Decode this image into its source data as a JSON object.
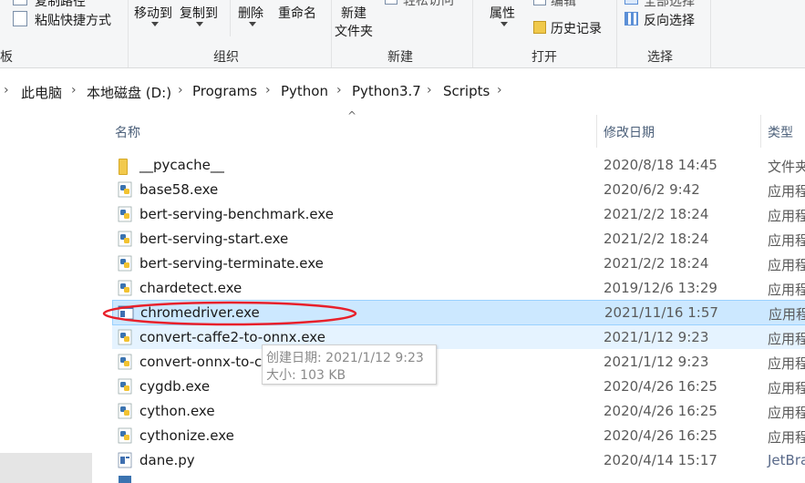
{
  "ribbon": {
    "copy_path": "复制路径",
    "paste_shortcut": "粘贴快捷方式",
    "move_to": "移动到",
    "copy_to": "复制到",
    "delete": "删除",
    "rename": "重命名",
    "new_folder_line1": "新建",
    "new_folder_line2": "文件夹",
    "easy_access": "轻松访问",
    "properties": "属性",
    "edit": "编辑",
    "history": "历史记录",
    "select_all": "全部选择",
    "invert_selection": "反向选择",
    "groups": {
      "clipboard_partial": "板",
      "organize": "组织",
      "new": "新建",
      "open": "打开",
      "select": "选择"
    }
  },
  "breadcrumb": [
    "此电脑",
    "本地磁盘 (D:)",
    "Programs",
    "Python",
    "Python3.7",
    "Scripts"
  ],
  "columns": {
    "name": "名称",
    "date": "修改日期",
    "type": "类型"
  },
  "files": [
    {
      "name": "__pycache__",
      "date": "2020/8/18 14:45",
      "type": "文件夹",
      "icon": "folder-icon"
    },
    {
      "name": "base58.exe",
      "date": "2020/6/2 9:42",
      "type": "应用程序",
      "icon": "python-exe-icon"
    },
    {
      "name": "bert-serving-benchmark.exe",
      "date": "2021/2/2 18:24",
      "type": "应用程序",
      "icon": "python-exe-icon"
    },
    {
      "name": "bert-serving-start.exe",
      "date": "2021/2/2 18:24",
      "type": "应用程序",
      "icon": "python-exe-icon"
    },
    {
      "name": "bert-serving-terminate.exe",
      "date": "2021/2/2 18:24",
      "type": "应用程序",
      "icon": "python-exe-icon"
    },
    {
      "name": "chardetect.exe",
      "date": "2019/12/6 13:29",
      "type": "应用程序",
      "icon": "python-exe-icon"
    },
    {
      "name": "chromedriver.exe",
      "date": "2021/11/16 1:57",
      "type": "应用程序",
      "icon": "app-window-icon"
    },
    {
      "name": "convert-caffe2-to-onnx.exe",
      "date": "2021/1/12 9:23",
      "type": "应用程序",
      "icon": "python-exe-icon"
    },
    {
      "name": "convert-onnx-to-caffe2.exe",
      "date": "2021/1/12 9:23",
      "type": "应用程序",
      "icon": "python-exe-icon"
    },
    {
      "name": "cygdb.exe",
      "date": "2020/4/26 16:25",
      "type": "应用程序",
      "icon": "python-exe-icon"
    },
    {
      "name": "cython.exe",
      "date": "2020/4/26 16:25",
      "type": "应用程序",
      "icon": "python-exe-icon"
    },
    {
      "name": "cythonize.exe",
      "date": "2020/4/26 16:25",
      "type": "应用程序",
      "icon": "python-exe-icon"
    },
    {
      "name": "dane.py",
      "date": "2020/4/14 15:17",
      "type": "JetBrains",
      "icon": "py-file-icon"
    }
  ],
  "tooltip": {
    "created": "创建日期: 2021/1/12 9:23",
    "size": "大小: 103 KB"
  },
  "colors": {
    "selection": "#cce8ff",
    "hover": "#e5f3ff",
    "annotation": "#e8202a"
  }
}
